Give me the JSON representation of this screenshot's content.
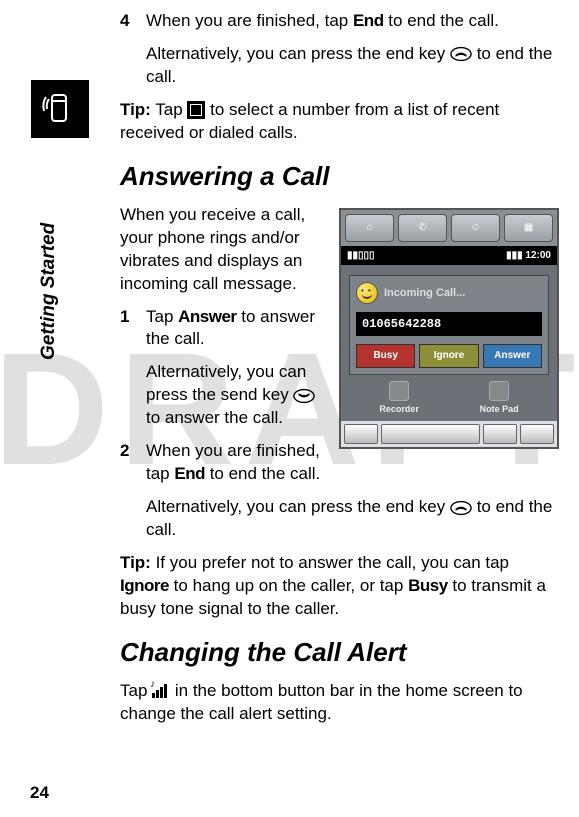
{
  "section_label": "Getting Started",
  "page_number": "24",
  "watermark": "DRAFT",
  "step4": {
    "num": "4",
    "text_a": "When you are finished, tap ",
    "end_label": "End",
    "text_b": " to end the call.",
    "alt_a": "Alternatively, you can press the end key ",
    "alt_b": " to end the call."
  },
  "tip1": {
    "prefix": "Tip:",
    "a": " Tap ",
    "b": " to select a number from a list of recent received or dialed calls."
  },
  "heading_answer": "Answering a Call",
  "answer_intro": "When you receive a call, your phone rings and/or vibrates and displays an incoming call message.",
  "astep1": {
    "num": "1",
    "a": "Tap ",
    "answer_label": "Answer",
    "b": " to answer the call.",
    "alt_a": "Alternatively, you can press the send key ",
    "alt_b": " to answer the call."
  },
  "astep2": {
    "num": "2",
    "a": "When you are finished, tap ",
    "end_label": "End",
    "b": " to end the call.",
    "alt_a": "Alternatively, you can press the end key ",
    "alt_b": " to end the call."
  },
  "tip2": {
    "prefix": "Tip:",
    "a": " If you prefer not to answer the call, you can tap ",
    "ignore_label": "Ignore",
    "b": " to hang up on the caller, or tap ",
    "busy_label": "Busy",
    "c": " to transmit a busy tone signal to the caller."
  },
  "heading_change": "Changing the Call Alert",
  "change_text_a": "Tap ",
  "change_text_b": " in the bottom button bar in the home screen to change the call alert setting.",
  "phone": {
    "signal": "▮▮▯▯▯",
    "battery": "▮▮▮",
    "time": "12:00",
    "incoming": "Incoming Call...",
    "number": "01065642288",
    "busy": "Busy",
    "ignore": "Ignore",
    "answer": "Answer",
    "recorder": "Recorder",
    "notepad": "Note Pad"
  }
}
